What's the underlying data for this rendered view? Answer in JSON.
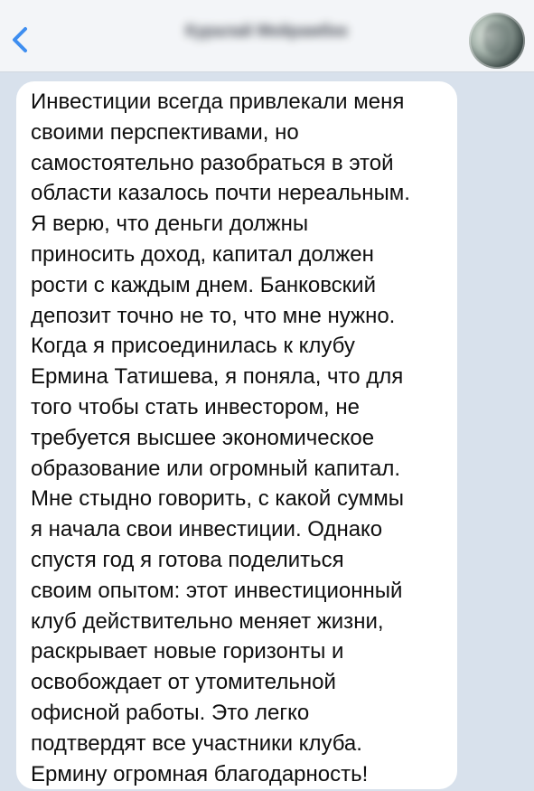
{
  "header": {
    "title": "Куралай Мейрамбек"
  },
  "message": {
    "text": "Инвестиции всегда привлекали меня\nсвоими перспективами, но\nсамостоятельно разобраться в этой\nобласти казалось почти нереальным.\nЯ верю, что деньги должны\nприносить доход, капитал должен\nрости с каждым днем. Банковский\nдепозит точно не то, что мне нужно.\nКогда я присоединилась к клубу\nЕрмина Татишева, я поняла, что для\nтого чтобы стать инвестором, не\nтребуется высшее экономическое\nобразование или огромный капитал.\nМне стыдно говорить, с какой суммы\nя начала свои инвестиции. Однако\nспустя год я готова поделиться\nсвоим опытом: этот инвестиционный\nклуб действительно меняет жизни,\nраскрывает новые горизонты и\nосвобождает от утомительной\nофисной работы. Это легко\nподтвердят все участники клуба.\nЕрмину огромная благодарность!"
  }
}
